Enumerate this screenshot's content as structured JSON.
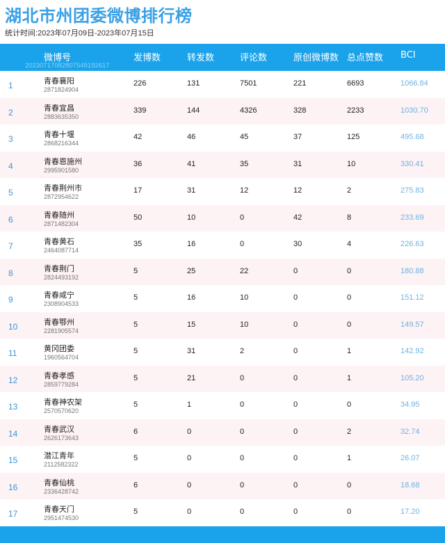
{
  "page": {
    "title": "湖北市州团委微博排行榜",
    "period": "统计时间:2023年07月09日-2023年07月15日"
  },
  "table": {
    "headers": {
      "account": "微博号",
      "posts": "发博数",
      "reposts": "转发数",
      "comments": "评论数",
      "original": "原创微博数",
      "likes": "总点赞数",
      "bci": "BCI"
    },
    "code": "20230717082807549192617",
    "rows": [
      {
        "rank": "1",
        "name": "青春襄阳",
        "uid": "2871824904",
        "posts": "226",
        "reposts": "131",
        "comments": "7501",
        "original": "221",
        "likes": "6693",
        "bci": "1066.84"
      },
      {
        "rank": "2",
        "name": "青春宜昌",
        "uid": "2883635350",
        "posts": "339",
        "reposts": "144",
        "comments": "4326",
        "original": "328",
        "likes": "2233",
        "bci": "1030.70"
      },
      {
        "rank": "3",
        "name": "青春十堰",
        "uid": "2868216344",
        "posts": "42",
        "reposts": "46",
        "comments": "45",
        "original": "37",
        "likes": "125",
        "bci": "495.68"
      },
      {
        "rank": "4",
        "name": "青春恩施州",
        "uid": "2995901580",
        "posts": "36",
        "reposts": "41",
        "comments": "35",
        "original": "31",
        "likes": "10",
        "bci": "330.41"
      },
      {
        "rank": "5",
        "name": "青春荆州市",
        "uid": "2872954622",
        "posts": "17",
        "reposts": "31",
        "comments": "12",
        "original": "12",
        "likes": "2",
        "bci": "275.83"
      },
      {
        "rank": "6",
        "name": "青春随州",
        "uid": "2871482304",
        "posts": "50",
        "reposts": "10",
        "comments": "0",
        "original": "42",
        "likes": "8",
        "bci": "233.69"
      },
      {
        "rank": "7",
        "name": "青春黄石",
        "uid": "2464087714",
        "posts": "35",
        "reposts": "16",
        "comments": "0",
        "original": "30",
        "likes": "4",
        "bci": "226.63"
      },
      {
        "rank": "8",
        "name": "青春荆门",
        "uid": "2824493192",
        "posts": "5",
        "reposts": "25",
        "comments": "22",
        "original": "0",
        "likes": "0",
        "bci": "180.88"
      },
      {
        "rank": "9",
        "name": "青春咸宁",
        "uid": "2308904533",
        "posts": "5",
        "reposts": "16",
        "comments": "10",
        "original": "0",
        "likes": "0",
        "bci": "151.12"
      },
      {
        "rank": "10",
        "name": "青春鄂州",
        "uid": "2281905574",
        "posts": "5",
        "reposts": "15",
        "comments": "10",
        "original": "0",
        "likes": "0",
        "bci": "149.57"
      },
      {
        "rank": "11",
        "name": "黄冈团委",
        "uid": "1960564704",
        "posts": "5",
        "reposts": "31",
        "comments": "2",
        "original": "0",
        "likes": "1",
        "bci": "142.92"
      },
      {
        "rank": "12",
        "name": "青春孝感",
        "uid": "2859779284",
        "posts": "5",
        "reposts": "21",
        "comments": "0",
        "original": "0",
        "likes": "1",
        "bci": "105.20"
      },
      {
        "rank": "13",
        "name": "青春神农架",
        "uid": "2570570620",
        "posts": "5",
        "reposts": "1",
        "comments": "0",
        "original": "0",
        "likes": "0",
        "bci": "34.95"
      },
      {
        "rank": "14",
        "name": "青春武汉",
        "uid": "2626173643",
        "posts": "6",
        "reposts": "0",
        "comments": "0",
        "original": "0",
        "likes": "2",
        "bci": "32.74"
      },
      {
        "rank": "15",
        "name": "潜江青年",
        "uid": "2112582322",
        "posts": "5",
        "reposts": "0",
        "comments": "0",
        "original": "0",
        "likes": "1",
        "bci": "26.07"
      },
      {
        "rank": "16",
        "name": "青春仙桃",
        "uid": "2336428742",
        "posts": "6",
        "reposts": "0",
        "comments": "0",
        "original": "0",
        "likes": "0",
        "bci": "18.68"
      },
      {
        "rank": "17",
        "name": "青春天门",
        "uid": "2951474530",
        "posts": "5",
        "reposts": "0",
        "comments": "0",
        "original": "0",
        "likes": "0",
        "bci": "17.20"
      }
    ]
  },
  "colors": {
    "accent": "#1aa3ea",
    "title": "#3aa0e6",
    "row_alt": "#fdf2f4",
    "bci_text": "#6fb3e0"
  }
}
